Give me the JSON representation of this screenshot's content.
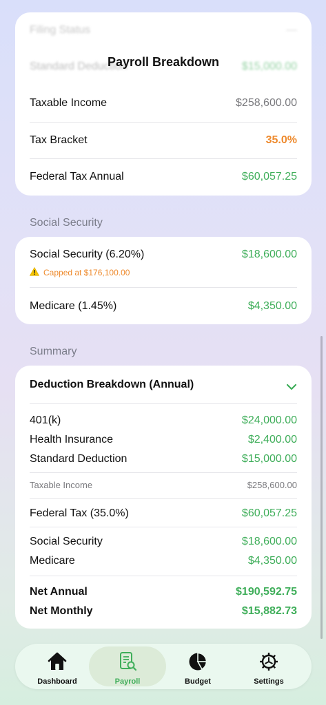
{
  "header": {
    "title": "Payroll Breakdown"
  },
  "federal_card": {
    "blurred_top_label": "Filing Status",
    "blurred_std_label": "Standard Deduction",
    "blurred_std_value": "$15,000.00",
    "rows": [
      {
        "label": "Taxable Income",
        "value": "$258,600.00"
      },
      {
        "label": "Tax Bracket",
        "value": "35.0%"
      },
      {
        "label": "Federal Tax Annual",
        "value": "$60,057.25"
      }
    ]
  },
  "social_security_section": {
    "label": "Social Security",
    "ss_label": "Social Security (6.20%)",
    "ss_value": "$18,600.00",
    "cap_note": "Capped at $176,100.00",
    "medicare_label": "Medicare (1.45%)",
    "medicare_value": "$4,350.00"
  },
  "summary_section": {
    "label": "Summary",
    "card_title": "Deduction Breakdown (Annual)",
    "deductions": [
      {
        "label": "401(k)",
        "value": "$24,000.00"
      },
      {
        "label": "Health Insurance",
        "value": "$2,400.00"
      },
      {
        "label": "Standard Deduction",
        "value": "$15,000.00"
      }
    ],
    "taxable_label": "Taxable Income",
    "taxable_value": "$258,600.00",
    "federal_label": "Federal Tax (35.0%)",
    "federal_value": "$60,057.25",
    "fica": [
      {
        "label": "Social Security",
        "value": "$18,600.00"
      },
      {
        "label": "Medicare",
        "value": "$4,350.00"
      }
    ],
    "net_annual_label": "Net Annual",
    "net_annual_value": "$190,592.75",
    "net_monthly_label": "Net Monthly",
    "net_monthly_value": "$15,882.73"
  },
  "nav": {
    "items": [
      {
        "label": "Dashboard",
        "icon": "house-icon"
      },
      {
        "label": "Payroll",
        "icon": "payroll-doc-icon"
      },
      {
        "label": "Budget",
        "icon": "pie-chart-icon"
      },
      {
        "label": "Settings",
        "icon": "gear-icon"
      }
    ],
    "active_index": 1
  },
  "colors": {
    "accent_green": "#3fae5a",
    "warning_orange": "#ee8a2d"
  }
}
